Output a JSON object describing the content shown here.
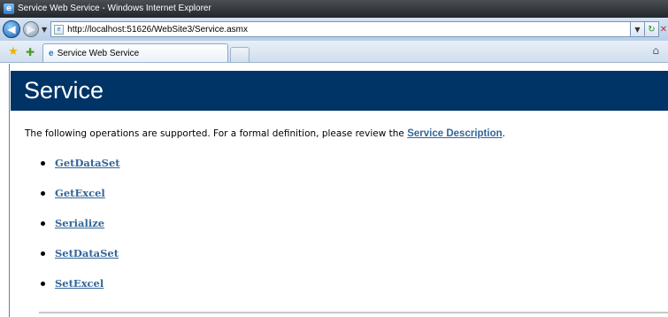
{
  "window": {
    "title": "Service Web Service - Windows Internet Explorer"
  },
  "address_bar": {
    "url": "http://localhost:51626/WebSite3/Service.asmx"
  },
  "tab": {
    "label": "Service Web Service"
  },
  "page": {
    "heading": "Service",
    "intro_text": "The following operations are supported. For a formal definition, please review the ",
    "intro_link": "Service Description",
    "intro_end": ".",
    "operations": [
      "GetDataSet",
      "GetExcel",
      "Serialize",
      "SetDataSet",
      "SetExcel"
    ]
  },
  "colors": {
    "heading_bg": "#003366",
    "link": "#336699"
  },
  "icons": {
    "back": "back-arrow-icon",
    "forward": "forward-arrow-icon",
    "favorites": "star-icon",
    "add_favorites": "add-favorite-icon",
    "home": "home-icon"
  }
}
